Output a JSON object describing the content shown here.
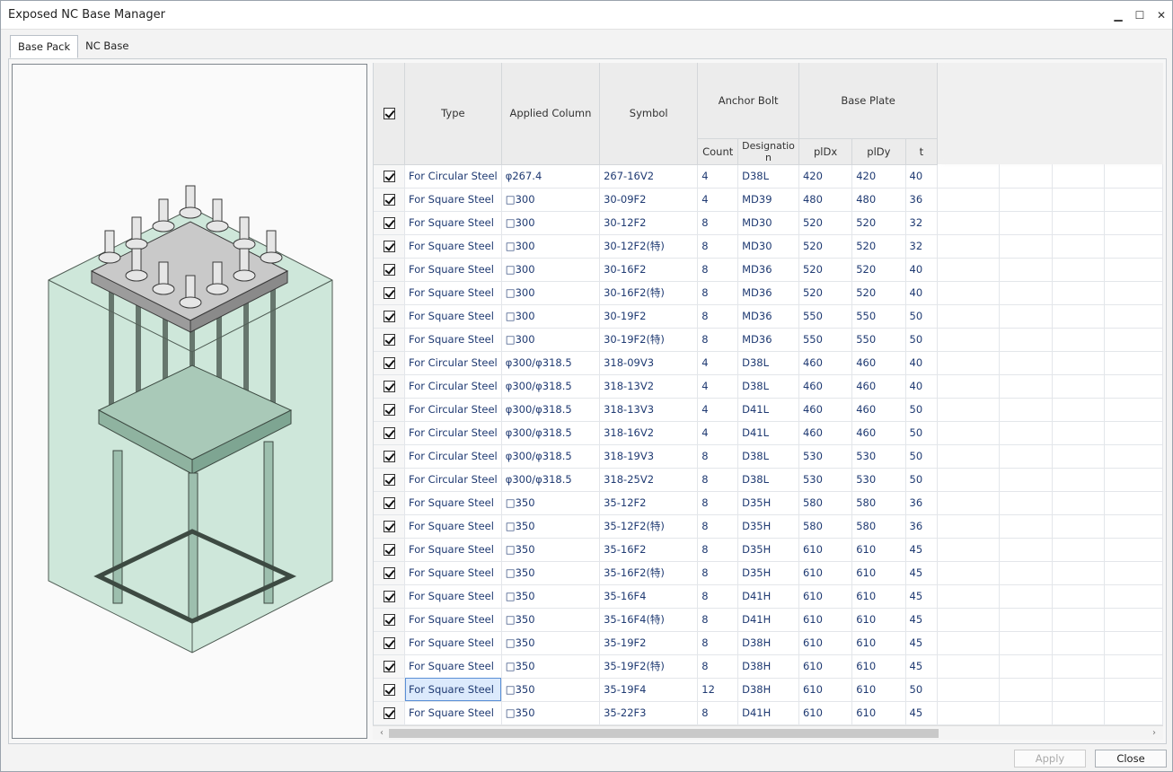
{
  "window": {
    "title": "Exposed NC Base Manager",
    "min_icon": "minimize-icon",
    "max_icon": "maximize-icon",
    "close_icon": "close-icon"
  },
  "tabs": [
    {
      "label": "Base Pack"
    },
    {
      "label": "NC Base"
    }
  ],
  "grid": {
    "headers": {
      "type": "Type",
      "applied_column": "Applied Column",
      "symbol": "Symbol",
      "anchor_bolt": "Anchor Bolt",
      "count": "Count",
      "designation": "Designatio\nn",
      "base_plate": "Base Plate",
      "pldx": "plDx",
      "pldy": "plDy",
      "t": "t"
    },
    "rows": [
      [
        "For Circular Steel",
        "φ267.4",
        "267-16V2",
        "4",
        "D38L",
        "420",
        "420",
        "40"
      ],
      [
        "For Square Steel",
        "□300",
        "30-09F2",
        "4",
        "MD39",
        "480",
        "480",
        "36"
      ],
      [
        "For Square Steel",
        "□300",
        "30-12F2",
        "8",
        "MD30",
        "520",
        "520",
        "32"
      ],
      [
        "For Square Steel",
        "□300",
        "30-12F2(特)",
        "8",
        "MD30",
        "520",
        "520",
        "32"
      ],
      [
        "For Square Steel",
        "□300",
        "30-16F2",
        "8",
        "MD36",
        "520",
        "520",
        "40"
      ],
      [
        "For Square Steel",
        "□300",
        "30-16F2(特)",
        "8",
        "MD36",
        "520",
        "520",
        "40"
      ],
      [
        "For Square Steel",
        "□300",
        "30-19F2",
        "8",
        "MD36",
        "550",
        "550",
        "50"
      ],
      [
        "For Square Steel",
        "□300",
        "30-19F2(特)",
        "8",
        "MD36",
        "550",
        "550",
        "50"
      ],
      [
        "For Circular Steel",
        "φ300/φ318.5",
        "318-09V3",
        "4",
        "D38L",
        "460",
        "460",
        "40"
      ],
      [
        "For Circular Steel",
        "φ300/φ318.5",
        "318-13V2",
        "4",
        "D38L",
        "460",
        "460",
        "40"
      ],
      [
        "For Circular Steel",
        "φ300/φ318.5",
        "318-13V3",
        "4",
        "D41L",
        "460",
        "460",
        "50"
      ],
      [
        "For Circular Steel",
        "φ300/φ318.5",
        "318-16V2",
        "4",
        "D41L",
        "460",
        "460",
        "50"
      ],
      [
        "For Circular Steel",
        "φ300/φ318.5",
        "318-19V3",
        "8",
        "D38L",
        "530",
        "530",
        "50"
      ],
      [
        "For Circular Steel",
        "φ300/φ318.5",
        "318-25V2",
        "8",
        "D38L",
        "530",
        "530",
        "50"
      ],
      [
        "For Square Steel",
        "□350",
        "35-12F2",
        "8",
        "D35H",
        "580",
        "580",
        "36"
      ],
      [
        "For Square Steel",
        "□350",
        "35-12F2(特)",
        "8",
        "D35H",
        "580",
        "580",
        "36"
      ],
      [
        "For Square Steel",
        "□350",
        "35-16F2",
        "8",
        "D35H",
        "610",
        "610",
        "45"
      ],
      [
        "For Square Steel",
        "□350",
        "35-16F2(特)",
        "8",
        "D35H",
        "610",
        "610",
        "45"
      ],
      [
        "For Square Steel",
        "□350",
        "35-16F4",
        "8",
        "D41H",
        "610",
        "610",
        "45"
      ],
      [
        "For Square Steel",
        "□350",
        "35-16F4(特)",
        "8",
        "D41H",
        "610",
        "610",
        "45"
      ],
      [
        "For Square Steel",
        "□350",
        "35-19F2",
        "8",
        "D38H",
        "610",
        "610",
        "45"
      ],
      [
        "For Square Steel",
        "□350",
        "35-19F2(特)",
        "8",
        "D38H",
        "610",
        "610",
        "45"
      ],
      [
        "For Square Steel",
        "□350",
        "35-19F4",
        "12",
        "D38H",
        "610",
        "610",
        "50"
      ],
      [
        "For Square Steel",
        "□350",
        "35-22F3",
        "8",
        "D41H",
        "610",
        "610",
        "45"
      ]
    ],
    "selected_row": 22
  },
  "buttons": {
    "apply": "Apply",
    "close": "Close"
  }
}
